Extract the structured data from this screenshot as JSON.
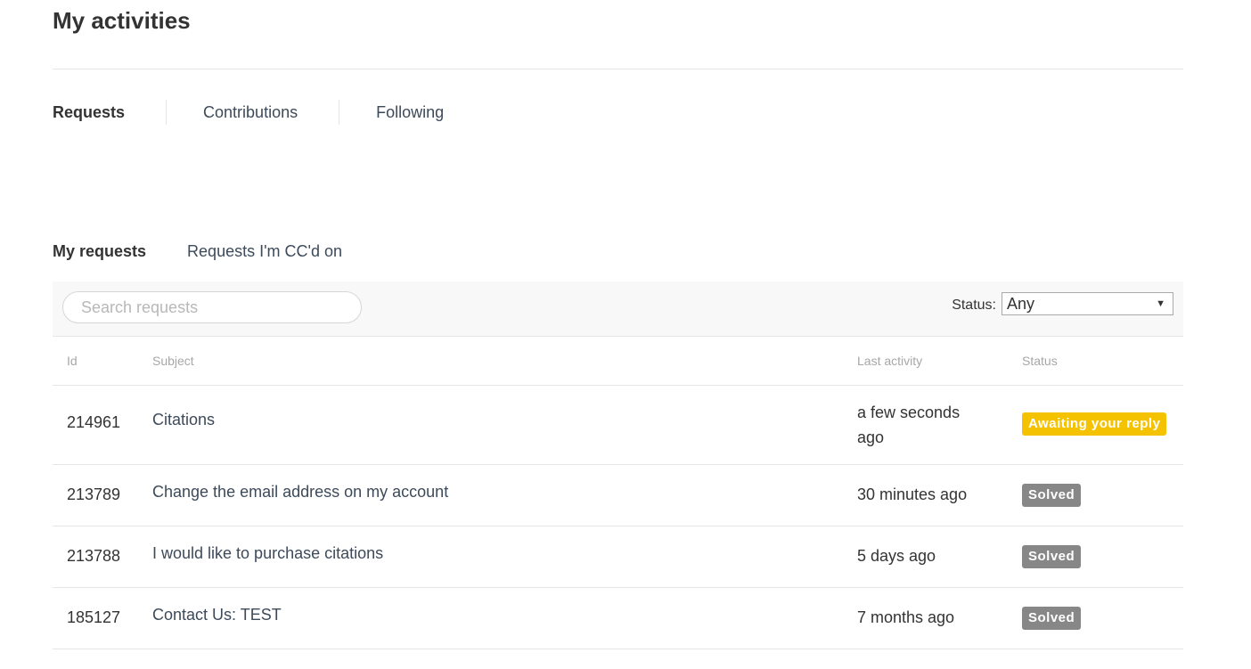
{
  "page": {
    "title": "My activities"
  },
  "main_nav": {
    "items": [
      {
        "label": "Requests",
        "active": true
      },
      {
        "label": "Contributions",
        "active": false
      },
      {
        "label": "Following",
        "active": false
      }
    ]
  },
  "sub_nav": {
    "items": [
      {
        "label": "My requests",
        "active": true
      },
      {
        "label": "Requests I'm CC'd on",
        "active": false
      }
    ]
  },
  "filter": {
    "search_placeholder": "Search requests",
    "status_label": "Status:",
    "status_value": "Any"
  },
  "table": {
    "columns": {
      "id": "Id",
      "subject": "Subject",
      "last_activity": "Last activity",
      "status": "Status"
    },
    "rows": [
      {
        "id": "214961",
        "subject": "Citations",
        "last_activity": "a few seconds ago",
        "status": "Awaiting your reply",
        "status_color": "#f5c200"
      },
      {
        "id": "213789",
        "subject": "Change the email address on my account",
        "last_activity": "30 minutes ago",
        "status": "Solved",
        "status_color": "#878787"
      },
      {
        "id": "213788",
        "subject": "I would like to purchase citations",
        "last_activity": "5 days ago",
        "status": "Solved",
        "status_color": "#878787"
      },
      {
        "id": "185127",
        "subject": "Contact Us: TEST",
        "last_activity": "7 months ago",
        "status": "Solved",
        "status_color": "#878787"
      }
    ]
  }
}
